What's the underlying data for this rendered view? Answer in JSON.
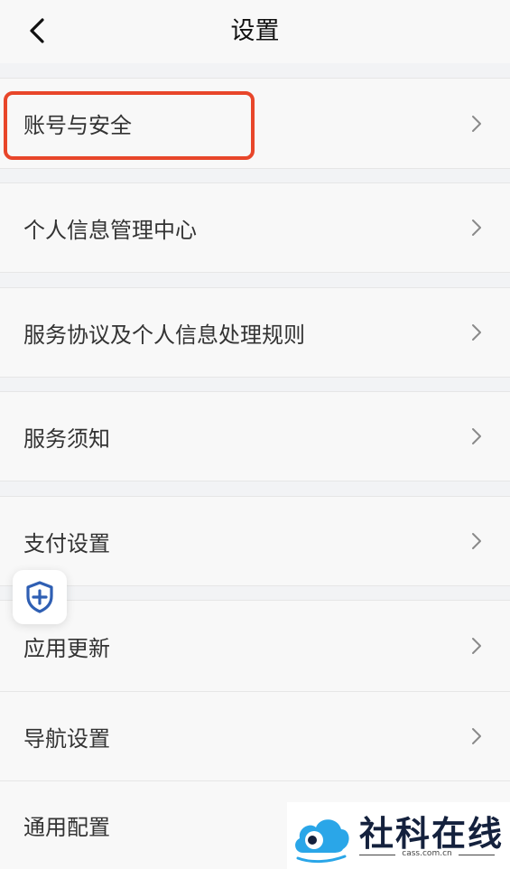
{
  "header": {
    "title": "设置"
  },
  "items": [
    {
      "label": "账号与安全"
    },
    {
      "label": "个人信息管理中心"
    },
    {
      "label": "服务协议及个人信息处理规则"
    },
    {
      "label": "服务须知"
    },
    {
      "label": "支付设置"
    },
    {
      "label": "应用更新"
    },
    {
      "label": "导航设置"
    },
    {
      "label": "通用配置"
    }
  ],
  "watermark": {
    "name": "社科在线",
    "domain": "cass.com.cn"
  },
  "colors": {
    "highlight": "#e8462a",
    "shield": "#2f5fb3",
    "watermark_blue": "#2aa6e8"
  }
}
